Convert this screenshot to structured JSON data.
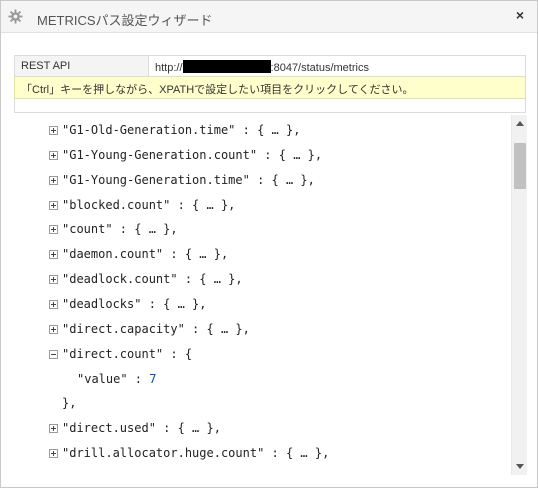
{
  "window": {
    "title": "METRICSパス設定ウィザード",
    "icon": "gear-icon",
    "close_label": "×"
  },
  "api": {
    "label": "REST API",
    "url_prefix": "http://",
    "url_suffix": ":8047/status/metrics"
  },
  "notice": "「Ctrl」キーを押しながら、XPATHで設定したい項目をクリックしてください。",
  "tree": {
    "items": [
      {
        "text": "\"G1-Old-Generation.time\" : { … },",
        "expanded": false
      },
      {
        "text": "\"G1-Young-Generation.count\" : { … },",
        "expanded": false
      },
      {
        "text": "\"G1-Young-Generation.time\" : { … },",
        "expanded": false
      },
      {
        "text": "\"blocked.count\" : { … },",
        "expanded": false
      },
      {
        "text": "\"count\" : { … },",
        "expanded": false
      },
      {
        "text": "\"daemon.count\" : { … },",
        "expanded": false
      },
      {
        "text": "\"deadlock.count\" : { … },",
        "expanded": false
      },
      {
        "text": "\"deadlocks\" : { … },",
        "expanded": false
      },
      {
        "text": "\"direct.capacity\" : { … },",
        "expanded": false
      },
      {
        "text": "\"direct.count\" : {",
        "expanded": true
      },
      {
        "text_key": "\"value\" : ",
        "text_value": "7",
        "child": true
      },
      {
        "text": "},",
        "closing": true
      },
      {
        "text": "\"direct.used\" : { … },",
        "expanded": false
      },
      {
        "text": "\"drill.allocator.huge.count\" : { … },",
        "expanded": false
      }
    ]
  },
  "colors": {
    "notice_bg": "#ffffcc",
    "value_number": "#0b4fa8"
  }
}
